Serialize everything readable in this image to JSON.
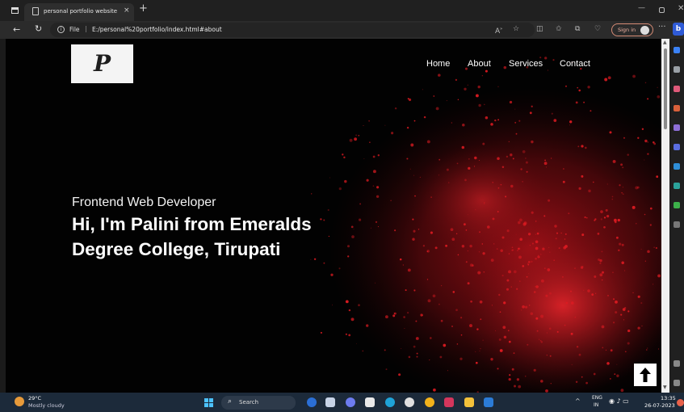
{
  "browser": {
    "tab_title": "personal portfolio website",
    "tab_close": "×",
    "new_tab": "+",
    "url_prefix": "File",
    "url_separator": "|",
    "url": "E:/personal%20portfolio/index.html#about",
    "info_glyph": "i",
    "sign_in_label": "Sign in",
    "more": "···",
    "copilot": "b"
  },
  "site": {
    "logo_letter": "P",
    "nav": {
      "home": "Home",
      "about": "About",
      "services": "Services",
      "contact": "Contact"
    },
    "hero": {
      "subtitle": "Frontend Web Developer",
      "title": "Hi, I'm Palini from Emeralds Degree College, Tirupati"
    }
  },
  "taskbar": {
    "temperature": "29°C",
    "weather": "Mostly cloudy",
    "search_label": "Search",
    "lang_line1": "ENG",
    "lang_line2": "IN",
    "time": "13:35",
    "date": "26-07-2023"
  },
  "colors": {
    "page_bg": "#020202",
    "splash_red": "#d0141a",
    "taskbar": "#1c2a3a",
    "accent_blue": "#4cc2ff"
  }
}
